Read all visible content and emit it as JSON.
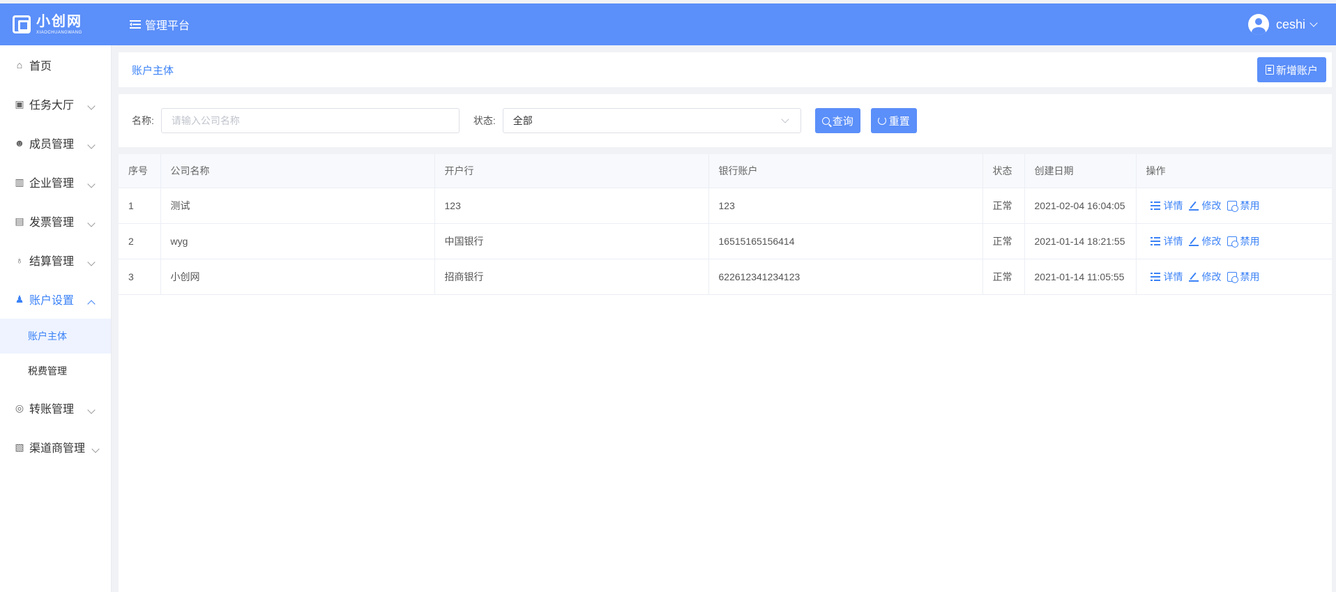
{
  "app": {
    "logo_title": "小创网",
    "logo_sub": "XIAOCHUANGWANG",
    "platform_label": "管理平台",
    "username": "ceshi"
  },
  "sidebar": {
    "items": [
      {
        "label": "首页",
        "icon": "home-icon"
      },
      {
        "label": "任务大厅",
        "icon": "task-icon"
      },
      {
        "label": "成员管理",
        "icon": "members-icon"
      },
      {
        "label": "企业管理",
        "icon": "building-icon"
      },
      {
        "label": "发票管理",
        "icon": "invoice-icon"
      },
      {
        "label": "结算管理",
        "icon": "settlement-icon"
      },
      {
        "label": "账户设置",
        "icon": "account-icon"
      },
      {
        "label": "转账管理",
        "icon": "transfer-icon"
      },
      {
        "label": "渠道商管理",
        "icon": "channel-icon"
      }
    ],
    "sub_items": [
      {
        "label": "账户主体",
        "active": true
      },
      {
        "label": "税费管理",
        "active": false
      }
    ]
  },
  "breadcrumb": "账户主体",
  "add_button": "新增账户",
  "filter": {
    "name_label": "名称:",
    "name_placeholder": "请输入公司名称",
    "status_label": "状态:",
    "status_value": "全部",
    "query_button": "查询",
    "reset_button": "重置"
  },
  "table": {
    "headers": [
      "序号",
      "公司名称",
      "开户行",
      "银行账户",
      "状态",
      "创建日期",
      "操作"
    ],
    "rows": [
      {
        "no": "1",
        "company": "测试",
        "bank": "123",
        "account": "123",
        "status": "正常",
        "date": "2021-02-04 16:04:05"
      },
      {
        "no": "2",
        "company": "wyg",
        "bank": "中国银行",
        "account": "16515165156414",
        "status": "正常",
        "date": "2021-01-14 18:21:55"
      },
      {
        "no": "3",
        "company": "小创网",
        "bank": "招商银行",
        "account": "622612341234123",
        "status": "正常",
        "date": "2021-01-14 11:05:55"
      }
    ],
    "actions": {
      "detail": "详情",
      "edit": "修改",
      "disable": "禁用"
    }
  },
  "colors": {
    "header_bg": "#5b8ff9",
    "accent": "#3b82f6",
    "active_sub_bg": "#eef3ff"
  }
}
